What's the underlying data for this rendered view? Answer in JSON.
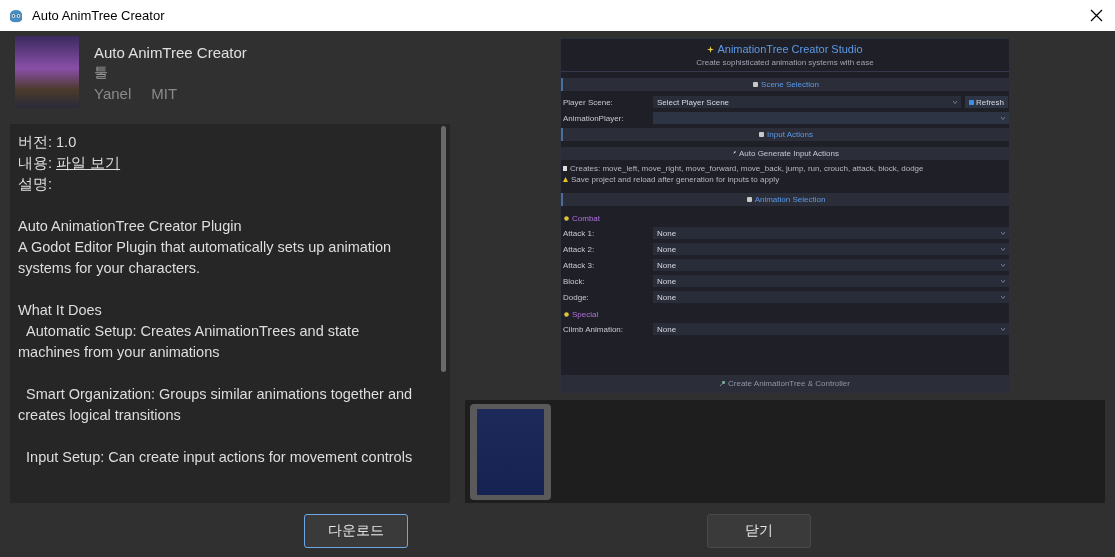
{
  "window": {
    "title": "Auto AnimTree Creator"
  },
  "asset": {
    "name": "Auto AnimTree Creator",
    "category": "툴",
    "author": "Yanel",
    "license": "MIT"
  },
  "description": {
    "version_label": "버전:",
    "version": "1.0",
    "content_label": "내용:",
    "content_link": "파일 보기",
    "desc_label": "설명:",
    "paragraphs": [
      [
        "Auto AnimationTree Creator Plugin",
        "A Godot Editor Plugin that automatically sets up animation systems for your characters."
      ],
      [
        "What It Does",
        "  Automatic Setup: Creates AnimationTrees and state machines from your animations"
      ],
      [
        "  Smart Organization: Groups similar animations together and creates logical transitions"
      ],
      [
        "  Input Setup: Can create input actions for movement controls"
      ]
    ]
  },
  "preview": {
    "title": "AnimationTree Creator Studio",
    "subtitle": "Create sophisticated animation systems with ease",
    "items": [
      {
        "kind": "section",
        "text": "Scene Selection"
      },
      {
        "kind": "field",
        "label": "Player Scene:",
        "value": "Select Player Scene",
        "button": "Refresh"
      },
      {
        "kind": "field",
        "label": "AnimationPlayer:"
      },
      {
        "kind": "section",
        "text": "Input Actions"
      },
      {
        "kind": "action",
        "text": "Auto Generate Input Actions"
      },
      {
        "kind": "note",
        "text": "Creates: move_left, move_right, move_forward, move_back, jump, run, crouch, attack, block, dodge"
      },
      {
        "kind": "warning",
        "text": "Save project and reload after generation for inputs to apply"
      },
      {
        "kind": "section",
        "text": "Animation Selection"
      },
      {
        "kind": "group",
        "text": "Combat"
      },
      {
        "kind": "field",
        "label": "Attack 1:",
        "value": "None"
      },
      {
        "kind": "field",
        "label": "Attack 2:",
        "value": "None"
      },
      {
        "kind": "field",
        "label": "Attack 3:",
        "value": "None"
      },
      {
        "kind": "field",
        "label": "Block:",
        "value": "None"
      },
      {
        "kind": "field",
        "label": "Dodge:",
        "value": "None"
      },
      {
        "kind": "group",
        "text": "Special"
      },
      {
        "kind": "field",
        "label": "Climb Animation:",
        "value": "None"
      },
      {
        "kind": "footer",
        "text": "Create AnimationTree & Controller"
      }
    ]
  },
  "thumbnails": [
    {
      "selected": true
    }
  ],
  "buttons": [
    {
      "label": "다운로드",
      "focused": true
    },
    {
      "label": "닫기",
      "focused": false
    }
  ]
}
